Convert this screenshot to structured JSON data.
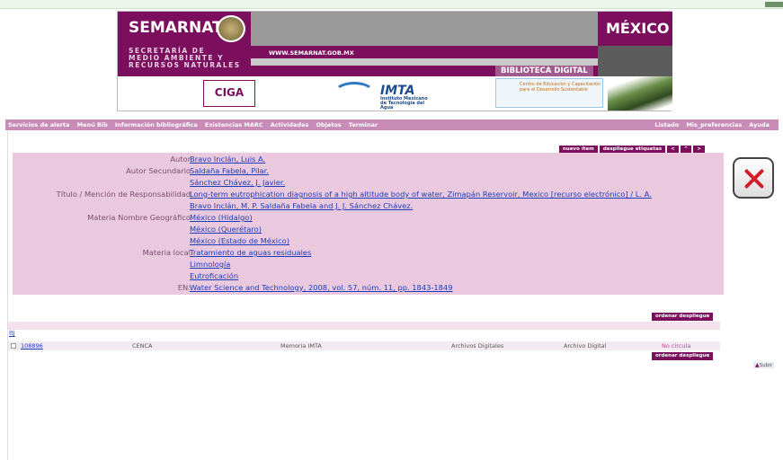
{
  "banner": {
    "brand": "SEMARNAT",
    "country": "MÉXICO",
    "secretaria": [
      "SECRETARÍA DE",
      "MEDIO AMBIENTE Y",
      "RECURSOS NATURALES"
    ],
    "website": "WWW.SEMARNAT.GOB.MX",
    "section": "BIBLIOTECA DIGITAL",
    "logo_ciga": "CIGA",
    "logo_imta": "IMTA",
    "logo_imta_sub": "Instituto Mexicano de Tecnología del Agua",
    "logo_cec": "Centro de Educación y Capacitación para el Desarrollo Sustentable"
  },
  "nav": {
    "left": [
      "Servicios de alerta",
      "Menú Bib",
      "Información bibliográfica",
      "Existencias MARC",
      "Actividades",
      "Objetos",
      "Terminar"
    ],
    "right": [
      "Listado",
      "Mis_preferencias",
      "Ayuda"
    ]
  },
  "buttons": {
    "new_item": "nuevo ítem",
    "show_labels": "despliegue etiquetas",
    "prev": "<",
    "up": "^",
    "next": ">",
    "order": "ordenar despliegue",
    "order2": "ordenar despliegue"
  },
  "record": [
    {
      "label": "Autor",
      "value": "Bravo Inclán, Luis A."
    },
    {
      "label": "Autor Secundario",
      "value": "Saldaña Fabela, Pilar."
    },
    {
      "label": "",
      "value": "Sánchez Chávez, J. Javier."
    },
    {
      "label": "Título / Mención de Responsabilidad",
      "value": "Long-term eutrophication diagnosis of a high altitude body of water, Zimapán Reservoir, Mexico [recurso electrónico] / L. A."
    },
    {
      "label": "",
      "value": "Bravo Inclán, M. P. Saldaña Fabela and J. J. Sánchez Chávez."
    },
    {
      "label": "Materia Nombre Geográfico",
      "value": "México (Hidalgo)"
    },
    {
      "label": "",
      "value": "México (Querétaro)"
    },
    {
      "label": "",
      "value": "México (Estado de México)"
    },
    {
      "label": "Materia local",
      "value": "Tratamiento de aguas residuales"
    },
    {
      "label": "",
      "value": "Limnología"
    },
    {
      "label": "",
      "value": "Eutroficación"
    },
    {
      "label": "EN:",
      "value": "Water Science and Technology, 2008, vol. 57, núm. 11, pp. 1843-1849"
    }
  ],
  "holdings": {
    "tab_label": "Ítj",
    "row": {
      "id": "108896",
      "library": "CENCA",
      "collection": "Memoria IMTA",
      "location": "Archivos Digitales",
      "type": "Archivo Digital",
      "status": "No circula"
    }
  },
  "top_link": "Subir",
  "colors": {
    "brand": "#7b0e5d",
    "nav": "#c98bb8",
    "panel": "#eac9df",
    "link": "#1d3db8"
  }
}
